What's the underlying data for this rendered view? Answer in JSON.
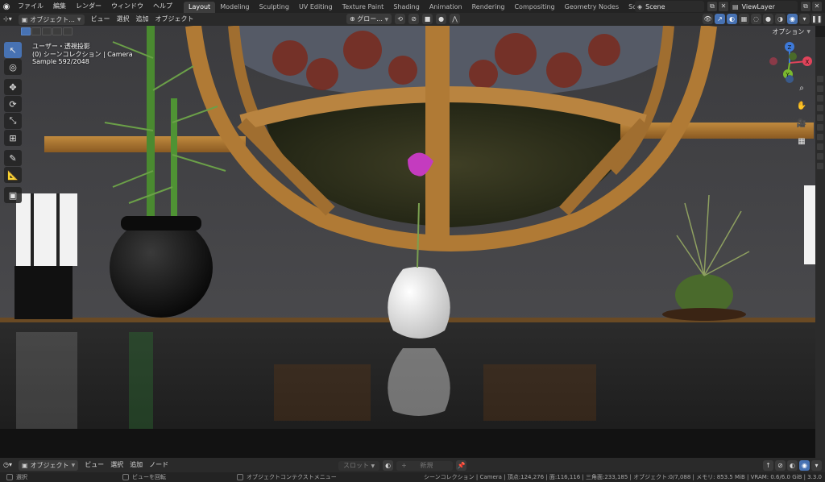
{
  "topbar": {
    "menus": [
      "ファイル",
      "編集",
      "レンダー",
      "ウィンドウ",
      "ヘルプ"
    ],
    "workspaces": [
      "Layout",
      "Modeling",
      "Sculpting",
      "UV Editing",
      "Texture Paint",
      "Shading",
      "Animation",
      "Rendering",
      "Compositing",
      "Geometry Nodes",
      "Scripting"
    ],
    "active_workspace": "Layout",
    "add_workspace": "+",
    "scene_name": "Scene",
    "view_layer": "ViewLayer"
  },
  "viewport_header": {
    "mode": "オブジェクト...",
    "menus": [
      "ビュー",
      "選択",
      "追加",
      "オブジェクト"
    ],
    "transform_orientation": "グロー...",
    "options_label": "オプション"
  },
  "overlay": {
    "view_name": "ユーザー・透視投影",
    "collection": "(0) シーンコレクション | Camera",
    "sample": "Sample 592/2048"
  },
  "gizmo": {
    "x_label": "X",
    "y_label": "Y",
    "z_label": "Z",
    "x_color": "#e0435a",
    "y_color": "#7ab82e",
    "z_color": "#3d79d9"
  },
  "timeline_header": {
    "mode": "オブジェクト",
    "menus": [
      "ビュー",
      "選択",
      "追加",
      "ノード"
    ],
    "slot_label": "スロット",
    "new_label": "新規"
  },
  "statusbar": {
    "select": "選択",
    "rotate_view": "ビューを回転",
    "context_menu": "オブジェクトコンテクストメニュー",
    "stats": "シーンコレクション | Camera | 頂点:124,276 | 面:116,116 | 三角面:233,185 | オブジェクト:0/7,088 | メモリ: 853.5 MiB | VRAM: 0.6/6.0 GiB | 3.3.0"
  },
  "colors": {
    "accent": "#4772b3",
    "topbar_bg": "#232323",
    "header_bg": "#2a2a2a"
  }
}
